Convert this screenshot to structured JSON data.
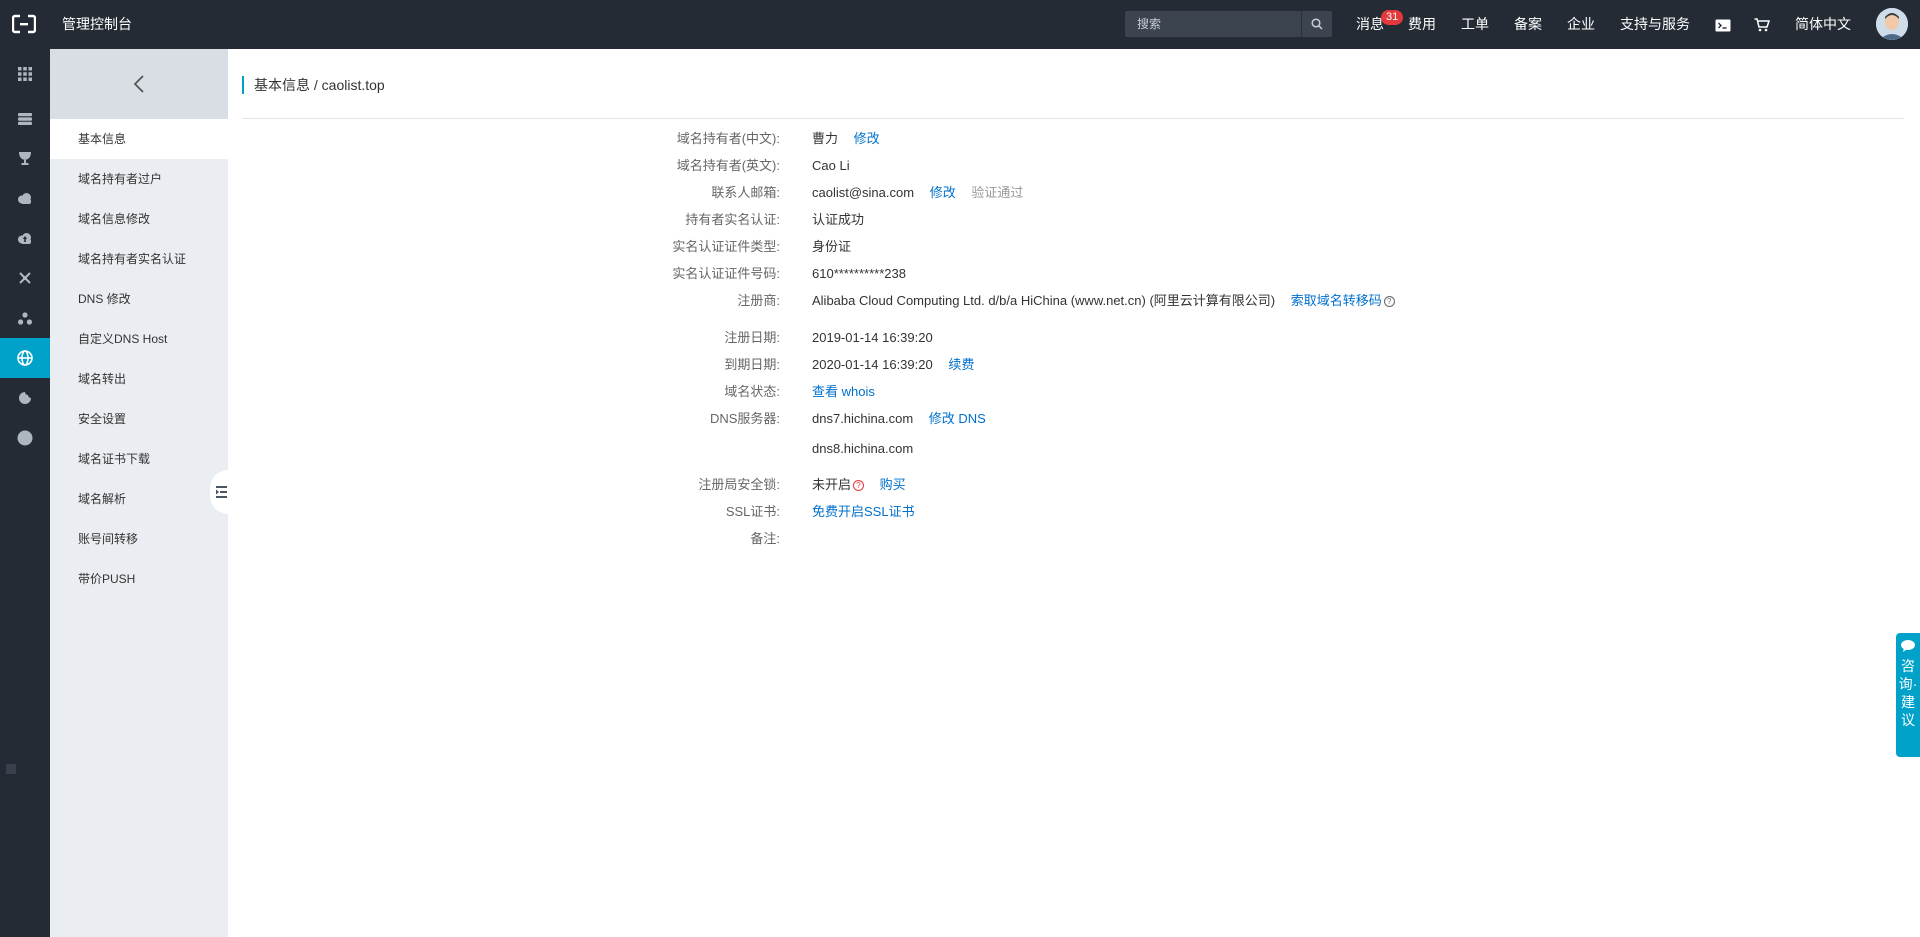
{
  "topbar": {
    "title": "管理控制台",
    "search_placeholder": "搜索",
    "nav": [
      {
        "label": "消息",
        "badge": "31"
      },
      {
        "label": "费用"
      },
      {
        "label": "工单"
      },
      {
        "label": "备案"
      },
      {
        "label": "企业"
      },
      {
        "label": "支持与服务"
      },
      {
        "label": "简体中文"
      }
    ]
  },
  "rail": {
    "icons": [
      "apps-grid-icon",
      "database-icon",
      "trophy-icon",
      "cloud-icon",
      "cloud-upload-icon",
      "network-icon",
      "cluster-icon",
      "globe-icon",
      "cookie-icon",
      "circle-icon"
    ],
    "active_index": 7
  },
  "subnav": {
    "items": [
      {
        "label": "基本信息",
        "active": true
      },
      {
        "label": "域名持有者过户"
      },
      {
        "label": "域名信息修改"
      },
      {
        "label": "域名持有者实名认证"
      },
      {
        "label": "DNS 修改"
      },
      {
        "label": "自定义DNS Host"
      },
      {
        "label": "域名转出"
      },
      {
        "label": "安全设置"
      },
      {
        "label": "域名证书下载"
      },
      {
        "label": "域名解析"
      },
      {
        "label": "账号间转移"
      },
      {
        "label": "带价PUSH"
      }
    ]
  },
  "breadcrumb": "基本信息 / caolist.top",
  "info": {
    "owner_cn": {
      "label": "域名持有者(中文):",
      "value": "曹力",
      "link": "修改"
    },
    "owner_en": {
      "label": "域名持有者(英文):",
      "value": "Cao Li"
    },
    "email": {
      "label": "联系人邮箱:",
      "value": "caolist@sina.com",
      "link": "修改",
      "status": "验证通过"
    },
    "realname": {
      "label": "持有者实名认证:",
      "value": "认证成功"
    },
    "id_type": {
      "label": "实名认证证件类型:",
      "value": "身份证"
    },
    "id_number": {
      "label": "实名认证证件号码:",
      "value": "610**********238"
    },
    "registrar": {
      "label": "注册商:",
      "value": "Alibaba Cloud Computing Ltd. d/b/a HiChina (www.net.cn) (阿里云计算有限公司)",
      "link": "索取域名转移码"
    },
    "reg_date": {
      "label": "注册日期:",
      "value": "2019-01-14 16:39:20"
    },
    "exp_date": {
      "label": "到期日期:",
      "value": "2020-01-14 16:39:20",
      "link": "续费"
    },
    "status": {
      "label": "域名状态:",
      "link": "查看 whois"
    },
    "dns": {
      "label": "DNS服务器:",
      "value1": "dns7.hichina.com",
      "link": "修改 DNS",
      "value2": "dns8.hichina.com"
    },
    "lock": {
      "label": "注册局安全锁:",
      "value": "未开启",
      "link": "购买"
    },
    "ssl": {
      "label": "SSL证书:",
      "link": "免费开启SSL证书"
    },
    "remark": {
      "label": "备注:"
    }
  },
  "feedback": {
    "label": "咨询·建议"
  },
  "colors": {
    "topbar": "#242b35",
    "accent": "#00a2ca",
    "link": "#0070cc",
    "badge": "#e4393c"
  }
}
